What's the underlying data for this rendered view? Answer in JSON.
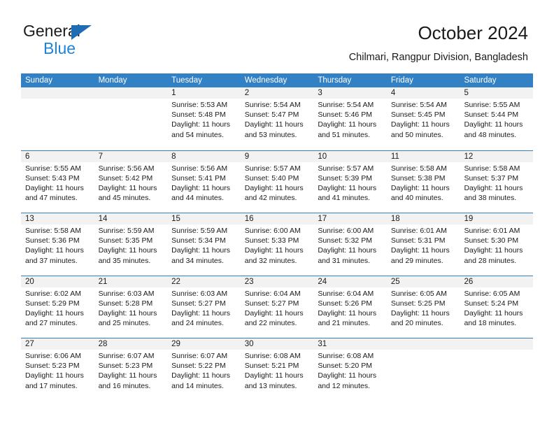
{
  "brand": {
    "name_part1": "General",
    "name_part2": "Blue",
    "triangle_color": "#1f6cb4",
    "blue_text_color": "#1f83d8"
  },
  "header": {
    "title": "October 2024",
    "location": "Chilmari, Rangpur Division, Bangladesh"
  },
  "theme": {
    "header_bar_color": "#3281c4",
    "date_strip_color": "#f2f2f2",
    "text_color": "#1a1a1a"
  },
  "weekdays": [
    "Sunday",
    "Monday",
    "Tuesday",
    "Wednesday",
    "Thursday",
    "Friday",
    "Saturday"
  ],
  "weeks": [
    [
      {
        "day": "",
        "sunrise": "",
        "sunset": "",
        "daylight_line1": "",
        "daylight_line2": ""
      },
      {
        "day": "",
        "sunrise": "",
        "sunset": "",
        "daylight_line1": "",
        "daylight_line2": ""
      },
      {
        "day": "1",
        "sunrise": "Sunrise: 5:53 AM",
        "sunset": "Sunset: 5:48 PM",
        "daylight_line1": "Daylight: 11 hours",
        "daylight_line2": "and 54 minutes."
      },
      {
        "day": "2",
        "sunrise": "Sunrise: 5:54 AM",
        "sunset": "Sunset: 5:47 PM",
        "daylight_line1": "Daylight: 11 hours",
        "daylight_line2": "and 53 minutes."
      },
      {
        "day": "3",
        "sunrise": "Sunrise: 5:54 AM",
        "sunset": "Sunset: 5:46 PM",
        "daylight_line1": "Daylight: 11 hours",
        "daylight_line2": "and 51 minutes."
      },
      {
        "day": "4",
        "sunrise": "Sunrise: 5:54 AM",
        "sunset": "Sunset: 5:45 PM",
        "daylight_line1": "Daylight: 11 hours",
        "daylight_line2": "and 50 minutes."
      },
      {
        "day": "5",
        "sunrise": "Sunrise: 5:55 AM",
        "sunset": "Sunset: 5:44 PM",
        "daylight_line1": "Daylight: 11 hours",
        "daylight_line2": "and 48 minutes."
      }
    ],
    [
      {
        "day": "6",
        "sunrise": "Sunrise: 5:55 AM",
        "sunset": "Sunset: 5:43 PM",
        "daylight_line1": "Daylight: 11 hours",
        "daylight_line2": "and 47 minutes."
      },
      {
        "day": "7",
        "sunrise": "Sunrise: 5:56 AM",
        "sunset": "Sunset: 5:42 PM",
        "daylight_line1": "Daylight: 11 hours",
        "daylight_line2": "and 45 minutes."
      },
      {
        "day": "8",
        "sunrise": "Sunrise: 5:56 AM",
        "sunset": "Sunset: 5:41 PM",
        "daylight_line1": "Daylight: 11 hours",
        "daylight_line2": "and 44 minutes."
      },
      {
        "day": "9",
        "sunrise": "Sunrise: 5:57 AM",
        "sunset": "Sunset: 5:40 PM",
        "daylight_line1": "Daylight: 11 hours",
        "daylight_line2": "and 42 minutes."
      },
      {
        "day": "10",
        "sunrise": "Sunrise: 5:57 AM",
        "sunset": "Sunset: 5:39 PM",
        "daylight_line1": "Daylight: 11 hours",
        "daylight_line2": "and 41 minutes."
      },
      {
        "day": "11",
        "sunrise": "Sunrise: 5:58 AM",
        "sunset": "Sunset: 5:38 PM",
        "daylight_line1": "Daylight: 11 hours",
        "daylight_line2": "and 40 minutes."
      },
      {
        "day": "12",
        "sunrise": "Sunrise: 5:58 AM",
        "sunset": "Sunset: 5:37 PM",
        "daylight_line1": "Daylight: 11 hours",
        "daylight_line2": "and 38 minutes."
      }
    ],
    [
      {
        "day": "13",
        "sunrise": "Sunrise: 5:58 AM",
        "sunset": "Sunset: 5:36 PM",
        "daylight_line1": "Daylight: 11 hours",
        "daylight_line2": "and 37 minutes."
      },
      {
        "day": "14",
        "sunrise": "Sunrise: 5:59 AM",
        "sunset": "Sunset: 5:35 PM",
        "daylight_line1": "Daylight: 11 hours",
        "daylight_line2": "and 35 minutes."
      },
      {
        "day": "15",
        "sunrise": "Sunrise: 5:59 AM",
        "sunset": "Sunset: 5:34 PM",
        "daylight_line1": "Daylight: 11 hours",
        "daylight_line2": "and 34 minutes."
      },
      {
        "day": "16",
        "sunrise": "Sunrise: 6:00 AM",
        "sunset": "Sunset: 5:33 PM",
        "daylight_line1": "Daylight: 11 hours",
        "daylight_line2": "and 32 minutes."
      },
      {
        "day": "17",
        "sunrise": "Sunrise: 6:00 AM",
        "sunset": "Sunset: 5:32 PM",
        "daylight_line1": "Daylight: 11 hours",
        "daylight_line2": "and 31 minutes."
      },
      {
        "day": "18",
        "sunrise": "Sunrise: 6:01 AM",
        "sunset": "Sunset: 5:31 PM",
        "daylight_line1": "Daylight: 11 hours",
        "daylight_line2": "and 29 minutes."
      },
      {
        "day": "19",
        "sunrise": "Sunrise: 6:01 AM",
        "sunset": "Sunset: 5:30 PM",
        "daylight_line1": "Daylight: 11 hours",
        "daylight_line2": "and 28 minutes."
      }
    ],
    [
      {
        "day": "20",
        "sunrise": "Sunrise: 6:02 AM",
        "sunset": "Sunset: 5:29 PM",
        "daylight_line1": "Daylight: 11 hours",
        "daylight_line2": "and 27 minutes."
      },
      {
        "day": "21",
        "sunrise": "Sunrise: 6:03 AM",
        "sunset": "Sunset: 5:28 PM",
        "daylight_line1": "Daylight: 11 hours",
        "daylight_line2": "and 25 minutes."
      },
      {
        "day": "22",
        "sunrise": "Sunrise: 6:03 AM",
        "sunset": "Sunset: 5:27 PM",
        "daylight_line1": "Daylight: 11 hours",
        "daylight_line2": "and 24 minutes."
      },
      {
        "day": "23",
        "sunrise": "Sunrise: 6:04 AM",
        "sunset": "Sunset: 5:27 PM",
        "daylight_line1": "Daylight: 11 hours",
        "daylight_line2": "and 22 minutes."
      },
      {
        "day": "24",
        "sunrise": "Sunrise: 6:04 AM",
        "sunset": "Sunset: 5:26 PM",
        "daylight_line1": "Daylight: 11 hours",
        "daylight_line2": "and 21 minutes."
      },
      {
        "day": "25",
        "sunrise": "Sunrise: 6:05 AM",
        "sunset": "Sunset: 5:25 PM",
        "daylight_line1": "Daylight: 11 hours",
        "daylight_line2": "and 20 minutes."
      },
      {
        "day": "26",
        "sunrise": "Sunrise: 6:05 AM",
        "sunset": "Sunset: 5:24 PM",
        "daylight_line1": "Daylight: 11 hours",
        "daylight_line2": "and 18 minutes."
      }
    ],
    [
      {
        "day": "27",
        "sunrise": "Sunrise: 6:06 AM",
        "sunset": "Sunset: 5:23 PM",
        "daylight_line1": "Daylight: 11 hours",
        "daylight_line2": "and 17 minutes."
      },
      {
        "day": "28",
        "sunrise": "Sunrise: 6:07 AM",
        "sunset": "Sunset: 5:23 PM",
        "daylight_line1": "Daylight: 11 hours",
        "daylight_line2": "and 16 minutes."
      },
      {
        "day": "29",
        "sunrise": "Sunrise: 6:07 AM",
        "sunset": "Sunset: 5:22 PM",
        "daylight_line1": "Daylight: 11 hours",
        "daylight_line2": "and 14 minutes."
      },
      {
        "day": "30",
        "sunrise": "Sunrise: 6:08 AM",
        "sunset": "Sunset: 5:21 PM",
        "daylight_line1": "Daylight: 11 hours",
        "daylight_line2": "and 13 minutes."
      },
      {
        "day": "31",
        "sunrise": "Sunrise: 6:08 AM",
        "sunset": "Sunset: 5:20 PM",
        "daylight_line1": "Daylight: 11 hours",
        "daylight_line2": "and 12 minutes."
      },
      {
        "day": "",
        "sunrise": "",
        "sunset": "",
        "daylight_line1": "",
        "daylight_line2": ""
      },
      {
        "day": "",
        "sunrise": "",
        "sunset": "",
        "daylight_line1": "",
        "daylight_line2": ""
      }
    ]
  ]
}
